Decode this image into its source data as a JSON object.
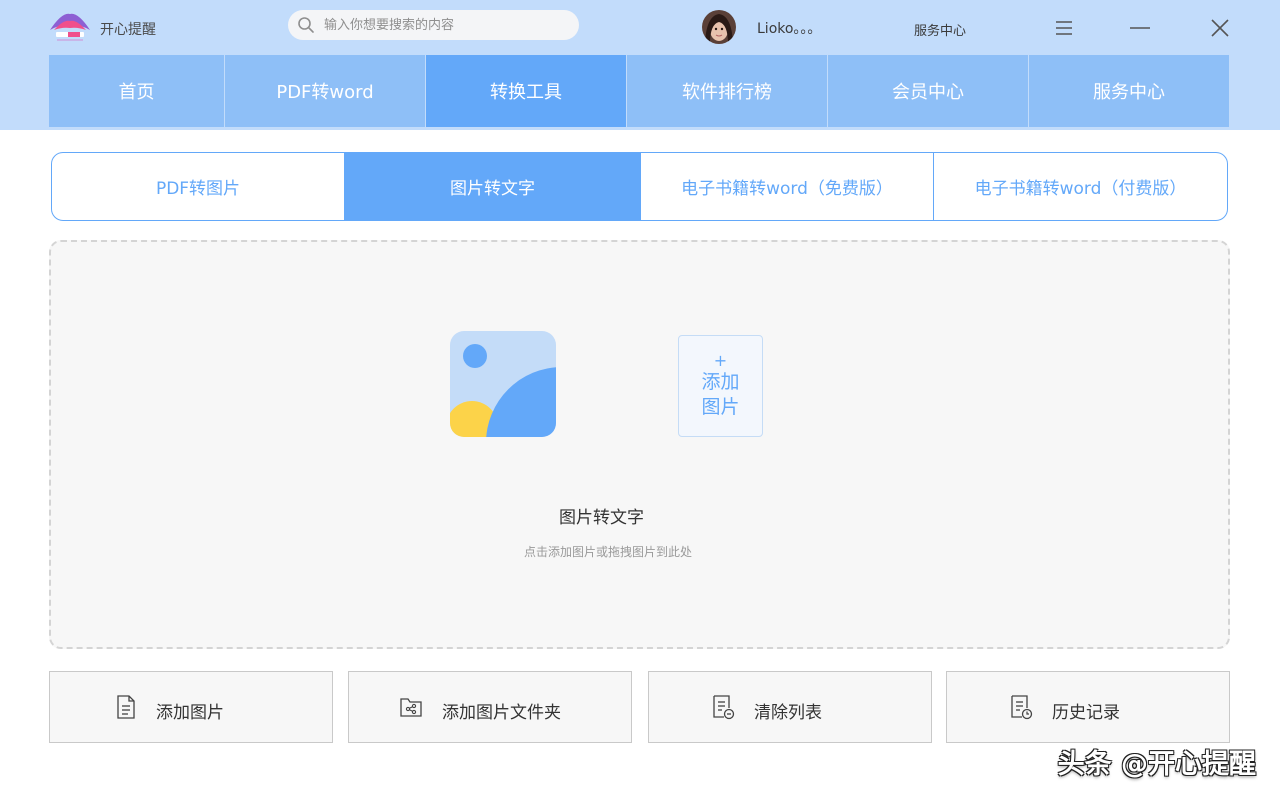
{
  "colors": {
    "header_bg": "#c2dcfb",
    "nav_bg": "#8ebff7",
    "nav_active": "#63a8f9",
    "accent": "#63a8f9",
    "dropzone_bg": "#f7f7f7",
    "illustration_yellow": "#fcd349",
    "illustration_light": "#c4dcf8"
  },
  "header": {
    "logo_icon": "app-logo-icon",
    "app_name": "开心提醒",
    "search": {
      "placeholder": "输入你想要搜索的内容",
      "value": "",
      "icon": "search-icon"
    },
    "user": {
      "avatar_icon": "avatar",
      "name": "Lioko。。。"
    },
    "service_label": "服务中心",
    "window_controls": [
      "menu-icon",
      "minimize-icon",
      "close-icon"
    ]
  },
  "nav": {
    "items": [
      {
        "label": "首页",
        "active": false
      },
      {
        "label": "PDF转word",
        "active": false
      },
      {
        "label": "转换工具",
        "active": true
      },
      {
        "label": "软件排行榜",
        "active": false
      },
      {
        "label": "会员中心",
        "active": false
      },
      {
        "label": "服务中心",
        "active": false
      }
    ]
  },
  "subtabs": {
    "items": [
      {
        "label": "PDF转图片",
        "active": false
      },
      {
        "label": "图片转文字",
        "active": true
      },
      {
        "label": "电子书籍转word（免费版）",
        "active": false
      },
      {
        "label": "电子书籍转word（付费版）",
        "active": false
      }
    ]
  },
  "dropzone": {
    "illustration_icon": "image-icon",
    "add_tile": {
      "plus": "+",
      "line1": "添加",
      "line2": "图片"
    },
    "title": "图片转文字",
    "hint": "点击添加图片或拖拽图片到此处"
  },
  "actions": [
    {
      "label": "添加图片",
      "icon": "file-icon"
    },
    {
      "label": "添加图片文件夹",
      "icon": "folder-icon"
    },
    {
      "label": "清除列表",
      "icon": "clear-list-icon"
    },
    {
      "label": "历史记录",
      "icon": "history-icon"
    }
  ],
  "watermark": "头条 @开心提醒"
}
